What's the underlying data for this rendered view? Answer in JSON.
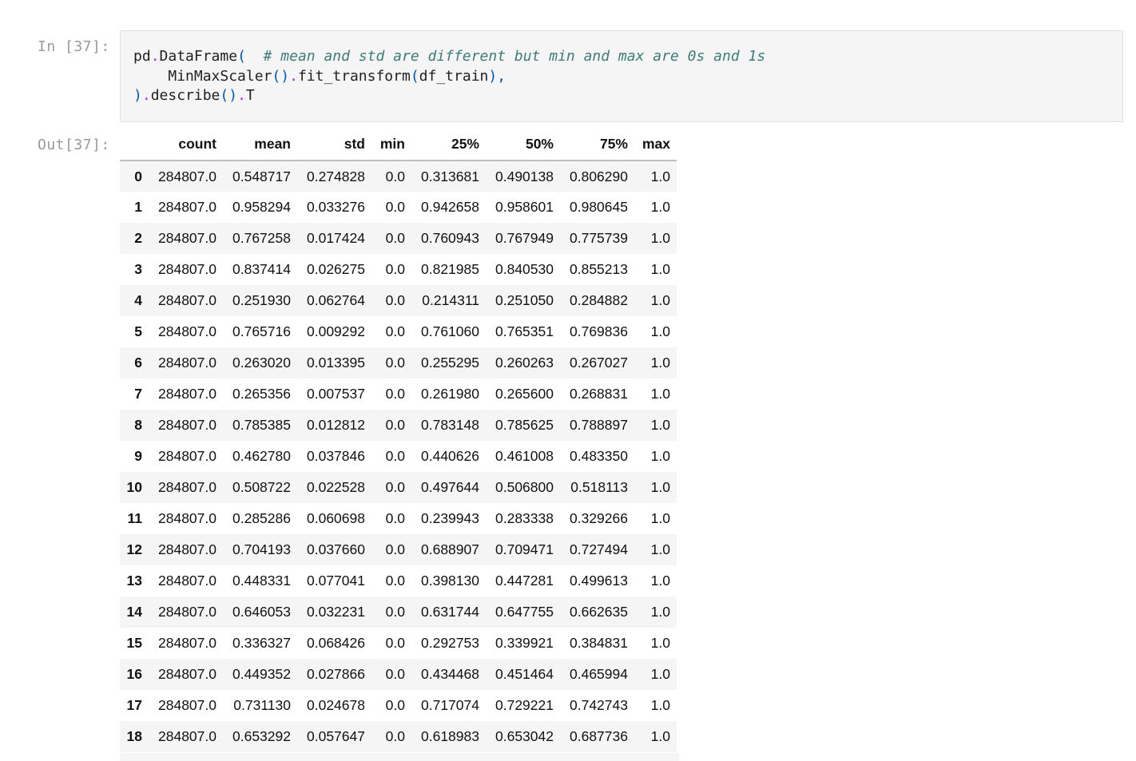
{
  "input_cell": {
    "prompt": "In [37]:",
    "code_line1_name": "pd",
    "code_line1_dot": ".",
    "code_line1_call": "DataFrame",
    "code_line1_paren": "(",
    "code_line1_comment": "# mean and std are different but min and max are 0s and 1s",
    "code_line2_call": "MinMaxScaler",
    "code_line2_parens": "()",
    "code_line2_dot": ".",
    "code_line2_method": "fit_transform",
    "code_line2_open": "(",
    "code_line2_arg": "df_train",
    "code_line2_close": "),",
    "code_line3_close": ")",
    "code_line3_dot1": ".",
    "code_line3_method": "describe",
    "code_line3_parens": "()",
    "code_line3_dot2": ".",
    "code_line3_attr": "T"
  },
  "output_cell": {
    "prompt": "Out[37]:",
    "columns": [
      "",
      "count",
      "mean",
      "std",
      "min",
      "25%",
      "50%",
      "75%",
      "max"
    ],
    "rows": [
      [
        "0",
        "284807.0",
        "0.548717",
        "0.274828",
        "0.0",
        "0.313681",
        "0.490138",
        "0.806290",
        "1.0"
      ],
      [
        "1",
        "284807.0",
        "0.958294",
        "0.033276",
        "0.0",
        "0.942658",
        "0.958601",
        "0.980645",
        "1.0"
      ],
      [
        "2",
        "284807.0",
        "0.767258",
        "0.017424",
        "0.0",
        "0.760943",
        "0.767949",
        "0.775739",
        "1.0"
      ],
      [
        "3",
        "284807.0",
        "0.837414",
        "0.026275",
        "0.0",
        "0.821985",
        "0.840530",
        "0.855213",
        "1.0"
      ],
      [
        "4",
        "284807.0",
        "0.251930",
        "0.062764",
        "0.0",
        "0.214311",
        "0.251050",
        "0.284882",
        "1.0"
      ],
      [
        "5",
        "284807.0",
        "0.765716",
        "0.009292",
        "0.0",
        "0.761060",
        "0.765351",
        "0.769836",
        "1.0"
      ],
      [
        "6",
        "284807.0",
        "0.263020",
        "0.013395",
        "0.0",
        "0.255295",
        "0.260263",
        "0.267027",
        "1.0"
      ],
      [
        "7",
        "284807.0",
        "0.265356",
        "0.007537",
        "0.0",
        "0.261980",
        "0.265600",
        "0.268831",
        "1.0"
      ],
      [
        "8",
        "284807.0",
        "0.785385",
        "0.012812",
        "0.0",
        "0.783148",
        "0.785625",
        "0.788897",
        "1.0"
      ],
      [
        "9",
        "284807.0",
        "0.462780",
        "0.037846",
        "0.0",
        "0.440626",
        "0.461008",
        "0.483350",
        "1.0"
      ],
      [
        "10",
        "284807.0",
        "0.508722",
        "0.022528",
        "0.0",
        "0.497644",
        "0.506800",
        "0.518113",
        "1.0"
      ],
      [
        "11",
        "284807.0",
        "0.285286",
        "0.060698",
        "0.0",
        "0.239943",
        "0.283338",
        "0.329266",
        "1.0"
      ],
      [
        "12",
        "284807.0",
        "0.704193",
        "0.037660",
        "0.0",
        "0.688907",
        "0.709471",
        "0.727494",
        "1.0"
      ],
      [
        "13",
        "284807.0",
        "0.448331",
        "0.077041",
        "0.0",
        "0.398130",
        "0.447281",
        "0.499613",
        "1.0"
      ],
      [
        "14",
        "284807.0",
        "0.646053",
        "0.032231",
        "0.0",
        "0.631744",
        "0.647755",
        "0.662635",
        "1.0"
      ],
      [
        "15",
        "284807.0",
        "0.336327",
        "0.068426",
        "0.0",
        "0.292753",
        "0.339921",
        "0.384831",
        "1.0"
      ],
      [
        "16",
        "284807.0",
        "0.449352",
        "0.027866",
        "0.0",
        "0.434468",
        "0.451464",
        "0.465994",
        "1.0"
      ],
      [
        "17",
        "284807.0",
        "0.731130",
        "0.024678",
        "0.0",
        "0.717074",
        "0.729221",
        "0.742743",
        "1.0"
      ],
      [
        "18",
        "284807.0",
        "0.653292",
        "0.057647",
        "0.0",
        "0.618983",
        "0.653042",
        "0.687736",
        "1.0"
      ]
    ]
  }
}
